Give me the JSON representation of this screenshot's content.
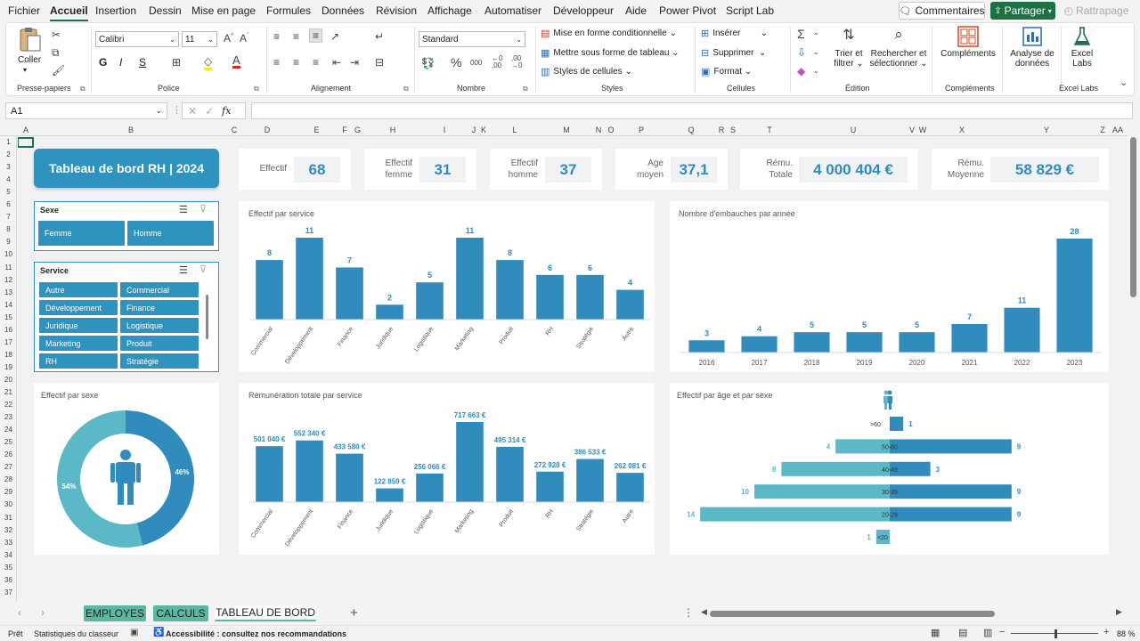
{
  "menu": {
    "items": [
      "Fichier",
      "Accueil",
      "Insertion",
      "Dessin",
      "Mise en page",
      "Formules",
      "Données",
      "Révision",
      "Affichage",
      "Automatiser",
      "Développeur",
      "Aide",
      "Power Pivot",
      "Script Lab"
    ],
    "comments": "Commentaires",
    "share": "Partager",
    "catchup": "Rattrapage"
  },
  "ribbon": {
    "paste": "Coller",
    "clipboard": "Presse-papiers",
    "font_name": "Calibri",
    "font_size": "11",
    "font_group": "Police",
    "align_group": "Alignement",
    "number_format": "Standard",
    "number_group": "Nombre",
    "cond_format": "Mise en forme conditionnelle",
    "format_table": "Mettre sous forme de tableau",
    "cell_styles": "Styles de cellules",
    "styles_group": "Styles",
    "insert": "Insérer",
    "delete": "Supprimer",
    "format": "Format",
    "cells_group": "Cellules",
    "sort_filter_1": "Trier et",
    "sort_filter_2": "filtrer",
    "find_1": "Rechercher et",
    "find_2": "sélectionner",
    "edit_group": "Édition",
    "addins": "Compléments",
    "addins_group": "Compléments",
    "analyze_1": "Analyse de",
    "analyze_2": "données",
    "excel_labs_1": "Excel",
    "excel_labs_2": "Labs",
    "labs_group": "Excel Labs"
  },
  "formula": {
    "namebox": "A1",
    "fx": "fx",
    "value": ""
  },
  "columns": [
    "A",
    "B",
    "C",
    "D",
    "E",
    "F",
    "G",
    "H",
    "I",
    "J",
    "K",
    "L",
    "M",
    "N",
    "O",
    "P",
    "Q",
    "R",
    "S",
    "T",
    "U",
    "V",
    "W",
    "X",
    "Y",
    "Z",
    "AA"
  ],
  "dashboard": {
    "title": "Tableau de bord RH | 2024",
    "kpis": [
      {
        "label1": "Effectif",
        "label2": "",
        "value": "68"
      },
      {
        "label1": "Effectif",
        "label2": "femme",
        "value": "31"
      },
      {
        "label1": "Effectif",
        "label2": "homme",
        "value": "37"
      },
      {
        "label1": "Age",
        "label2": "moyen",
        "value": "37,1"
      },
      {
        "label1": "Rému.",
        "label2": "Totale",
        "value": "4 000 404 €"
      },
      {
        "label1": "Rému.",
        "label2": "Moyenne",
        "value": "58 829 €"
      }
    ],
    "slicer_sexe": {
      "title": "Sexe",
      "items": [
        "Femme",
        "Homme"
      ]
    },
    "slicer_service": {
      "title": "Service",
      "items": [
        "Autre",
        "Commercial",
        "Développement",
        "Finance",
        "Juridique",
        "Logistique",
        "Marketing",
        "Produit",
        "RH",
        "Stratégie"
      ]
    }
  },
  "chart_data": [
    {
      "type": "bar",
      "title": "Effectif par service",
      "categories": [
        "Commercial",
        "Développement",
        "Finance",
        "Juridique",
        "Logistique",
        "Marketing",
        "Produit",
        "RH",
        "Stratégie",
        "Autre"
      ],
      "values": [
        8,
        11,
        7,
        2,
        5,
        11,
        8,
        6,
        6,
        4
      ],
      "ylim": [
        0,
        11
      ],
      "color": "#2f8cbd"
    },
    {
      "type": "bar",
      "title": "Nombre d'embauches par année",
      "categories": [
        "2016",
        "2017",
        "2018",
        "2019",
        "2020",
        "2021",
        "2022",
        "2023"
      ],
      "values": [
        3,
        4,
        5,
        5,
        5,
        7,
        11,
        28
      ],
      "ylim": [
        0,
        28
      ],
      "color": "#2f8cbd"
    },
    {
      "type": "pie",
      "title": "Effectif par sexe",
      "series": [
        {
          "name": "Femme",
          "value": 54,
          "label": "54%",
          "color": "#5bb8c6"
        },
        {
          "name": "Homme",
          "value": 46,
          "label": "46%",
          "color": "#2f8cbd"
        }
      ]
    },
    {
      "type": "bar",
      "title": "Rémunération totale par service",
      "categories": [
        "Commercial",
        "Développement",
        "Finance",
        "Juridique",
        "Logistique",
        "Marketing",
        "Produit",
        "RH",
        "Stratégie",
        "Autre"
      ],
      "values": [
        501040,
        552340,
        433580,
        122859,
        256066,
        717663,
        495314,
        272928,
        386533,
        262081
      ],
      "labels": [
        "501 040 €",
        "552 340 €",
        "433 580 €",
        "122 859 €",
        "256 066 €",
        "717 663 €",
        "495 314 €",
        "272 928 €",
        "386 533 €",
        "262 081 €"
      ],
      "ylim": [
        0,
        717663
      ],
      "color": "#2f8cbd"
    },
    {
      "type": "bar",
      "title": "Effectif par âge et par sexe",
      "categories": [
        ">60",
        "50-60",
        "40-49",
        "30-39",
        "20-29",
        "<20"
      ],
      "series": [
        {
          "name": "Femme",
          "values": [
            0,
            4,
            8,
            10,
            14,
            1
          ],
          "color": "#5bb8c6"
        },
        {
          "name": "Homme",
          "values": [
            1,
            9,
            3,
            9,
            9,
            0
          ],
          "color": "#2f8cbd"
        }
      ]
    }
  ],
  "tabs": {
    "items": [
      "EMPLOYES",
      "CALCULS",
      "TABLEAU DE BORD"
    ]
  },
  "status": {
    "ready": "Prêt",
    "stats": "Statistiques du classeur",
    "accessibility": "Accessibilité : consultez nos recommandations",
    "zoom": "88 %"
  }
}
